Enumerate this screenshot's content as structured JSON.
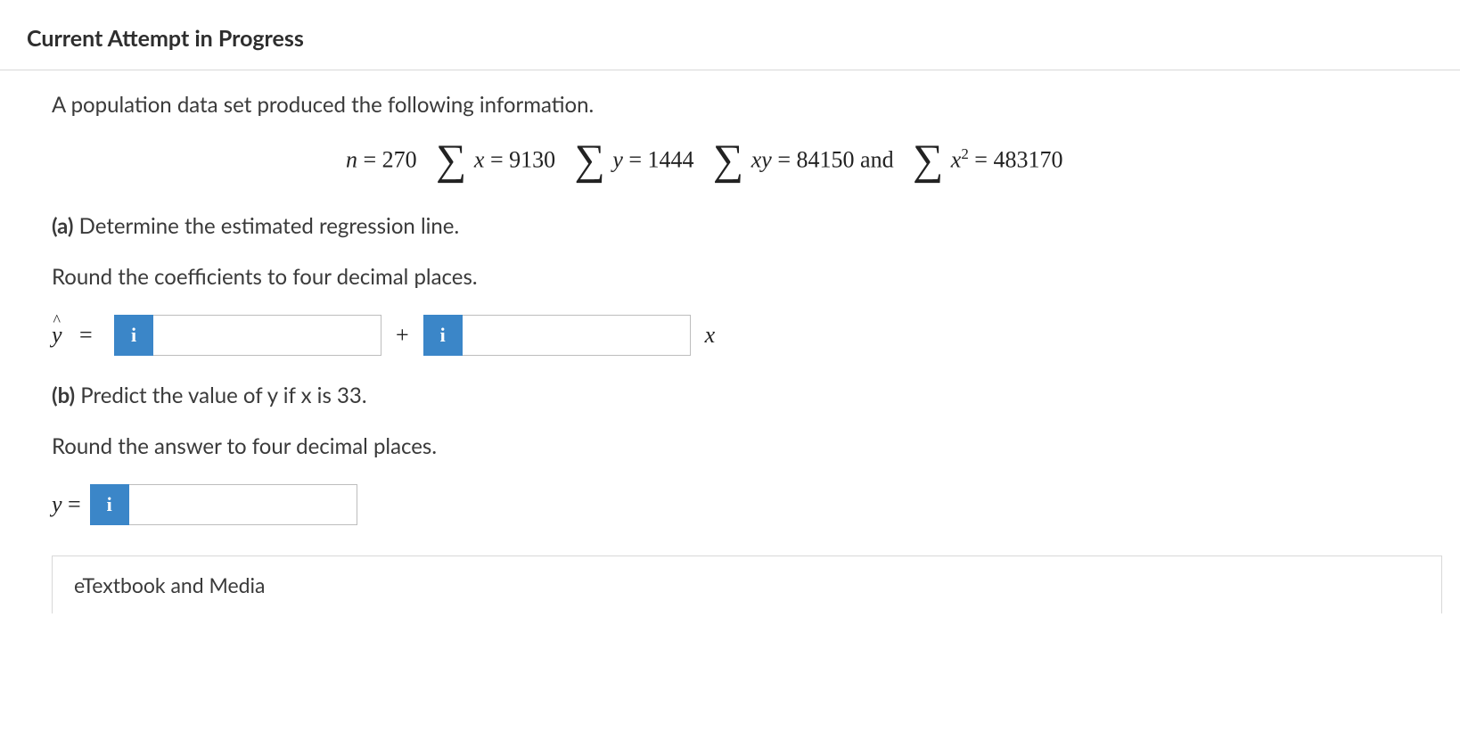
{
  "header": {
    "title": "Current Attempt in Progress"
  },
  "intro": "A population data set produced the following information.",
  "equation": {
    "n_label": "n",
    "n_value": "270",
    "sum_x_var": "x",
    "sum_x_value": "9130",
    "sum_y_var": "y",
    "sum_y_value": "1444",
    "sum_xy_var": "xy",
    "sum_xy_value": "84150",
    "and_text": "and",
    "sum_x2_var_base": "x",
    "sum_x2_var_exp": "2",
    "sum_x2_value": "483170"
  },
  "part_a": {
    "label": "(a)",
    "text": "Determine the estimated regression line.",
    "instruction": "Round the coefficients to four decimal places.",
    "yhat": "y",
    "equals": "=",
    "plus": "+",
    "x_suffix": "x",
    "info_label": "i",
    "input1_value": "",
    "input2_value": ""
  },
  "part_b": {
    "label": "(b)",
    "text": "Predict the value of y if x is 33.",
    "instruction": "Round the answer to four decimal places.",
    "y_prefix": "y =",
    "info_label": "i",
    "input_value": ""
  },
  "footer": {
    "etextbook_label": "eTextbook and Media"
  }
}
